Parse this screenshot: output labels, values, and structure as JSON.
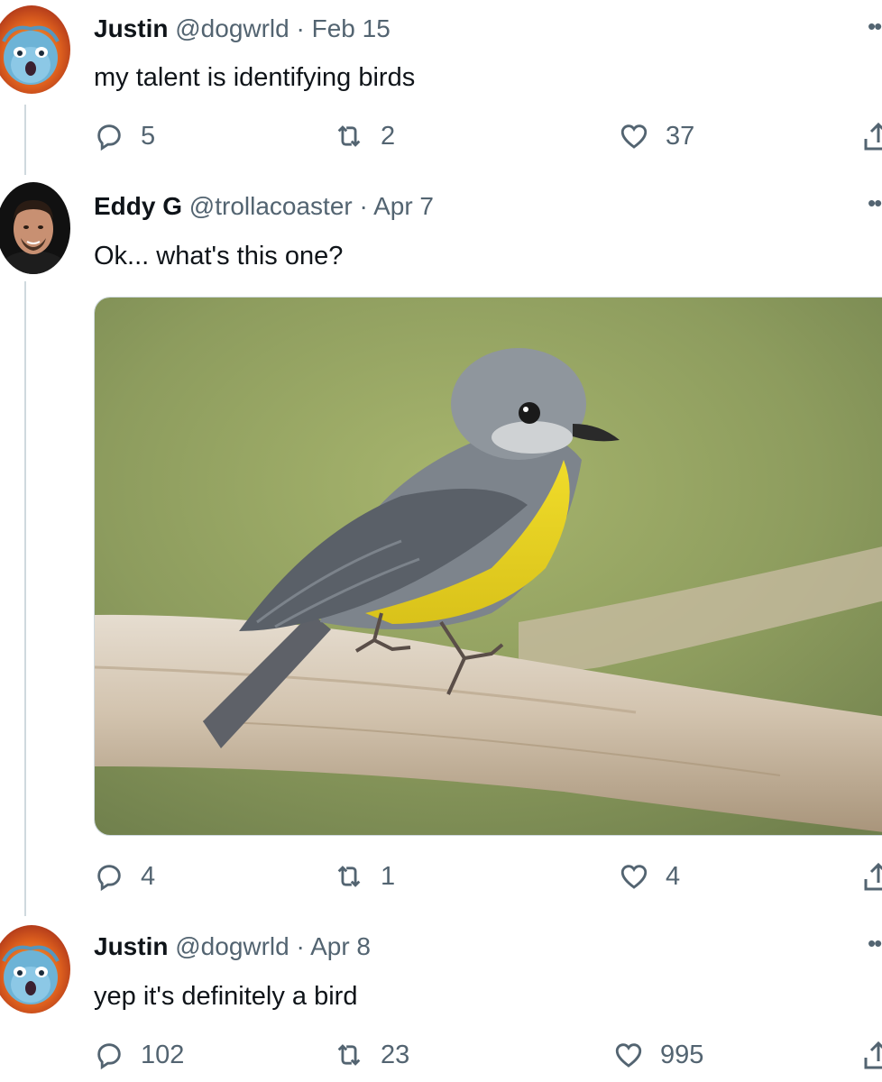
{
  "tweets": [
    {
      "name": "Justin",
      "handle": "@dogwrld",
      "date": "Feb 15",
      "text": "my talent is identifying birds",
      "replies": "5",
      "retweets": "2",
      "likes": "37",
      "avatar": "blue-cartoon-fire-avatar"
    },
    {
      "name": "Eddy G",
      "handle": "@trollacoaster",
      "date": "Apr 7",
      "text": "Ok... what's this one?",
      "replies": "4",
      "retweets": "1",
      "likes": "4",
      "avatar": "man-portrait-avatar",
      "media": "photo-yellow-robin-on-branch"
    },
    {
      "name": "Justin",
      "handle": "@dogwrld",
      "date": "Apr 8",
      "text": "yep it's definitely a bird",
      "replies": "102",
      "retweets": "23",
      "likes": "995",
      "avatar": "blue-cartoon-fire-avatar"
    }
  ],
  "separator": " · ",
  "icons": {
    "reply": "reply-icon",
    "retweet": "retweet-icon",
    "like": "heart-icon",
    "share": "share-icon",
    "more": "more-icon"
  },
  "colors": {
    "text": "#0f1419",
    "secondary": "#536471",
    "thread_line": "#cfd9de"
  }
}
